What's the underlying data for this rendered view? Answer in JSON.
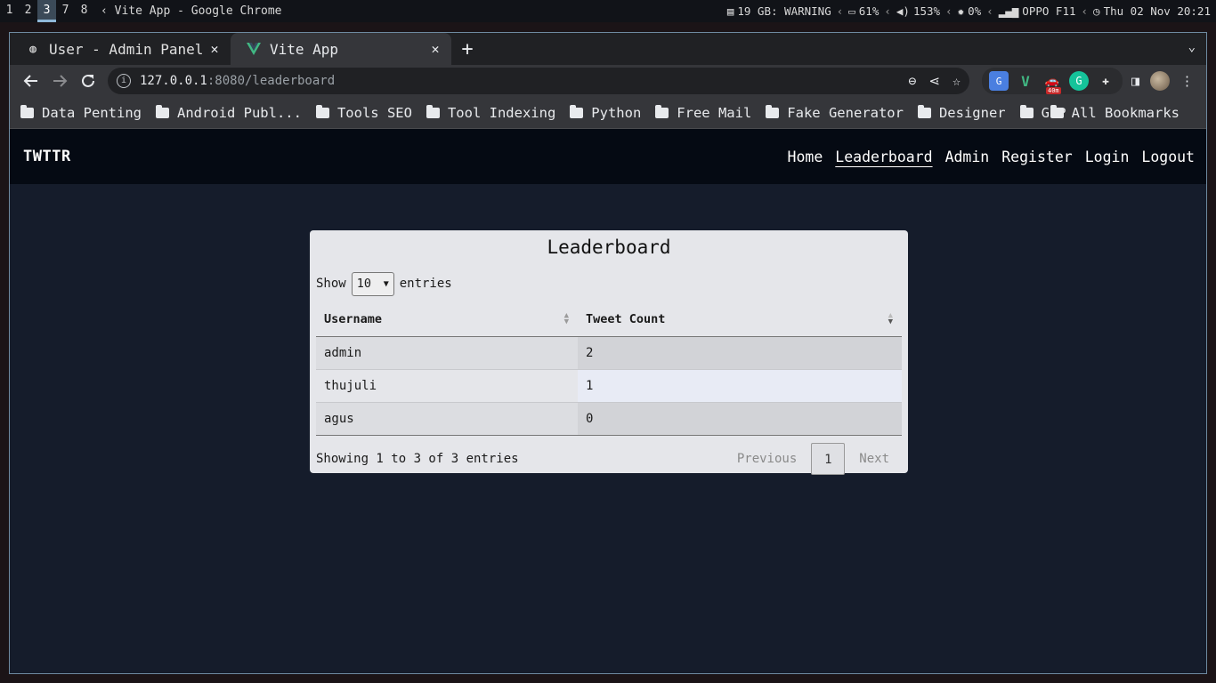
{
  "system_bar": {
    "workspaces": [
      "1",
      "2",
      "3",
      "7",
      "8"
    ],
    "active_workspace": "3",
    "window_title": "‹ Vite App - Google Chrome",
    "status": {
      "disk": "19 GB: WARNING",
      "battery": "61%",
      "volume": "153%",
      "brightness": "0%",
      "wifi": "OPPO F11",
      "clock": "Thu 02 Nov 20:21"
    }
  },
  "browser": {
    "tabs": [
      {
        "title": "User - Admin Panel",
        "icon": "globe-icon"
      },
      {
        "title": "Vite App",
        "icon": "vue-logo-icon"
      }
    ],
    "active_tab": 1,
    "url_host": "127.0.0.1",
    "url_rest": ":8080/leaderboard",
    "extension_badge": "40m",
    "bookmarks": [
      "Data Penting",
      "Android Publ...",
      "Tools SEO",
      "Tool Indexing",
      "Python",
      "Free Mail",
      "Fake Generator",
      "Designer",
      "GCP"
    ],
    "all_bookmarks": "All Bookmarks"
  },
  "app": {
    "brand": "TWTTR",
    "nav": [
      "Home",
      "Leaderboard",
      "Admin",
      "Register",
      "Login",
      "Logout"
    ],
    "active_nav": "Leaderboard"
  },
  "leaderboard": {
    "title": "Leaderboard",
    "show_label": "Show",
    "entries_value": "10",
    "entries_label": "entries",
    "columns": [
      "Username",
      "Tweet Count"
    ],
    "rows": [
      {
        "username": "admin",
        "tweet_count": "2"
      },
      {
        "username": "thujuli",
        "tweet_count": "1"
      },
      {
        "username": "agus",
        "tweet_count": "0"
      }
    ],
    "info": "Showing 1 to 3 of 3 entries",
    "pagination": {
      "previous": "Previous",
      "current": "1",
      "next": "Next"
    }
  }
}
